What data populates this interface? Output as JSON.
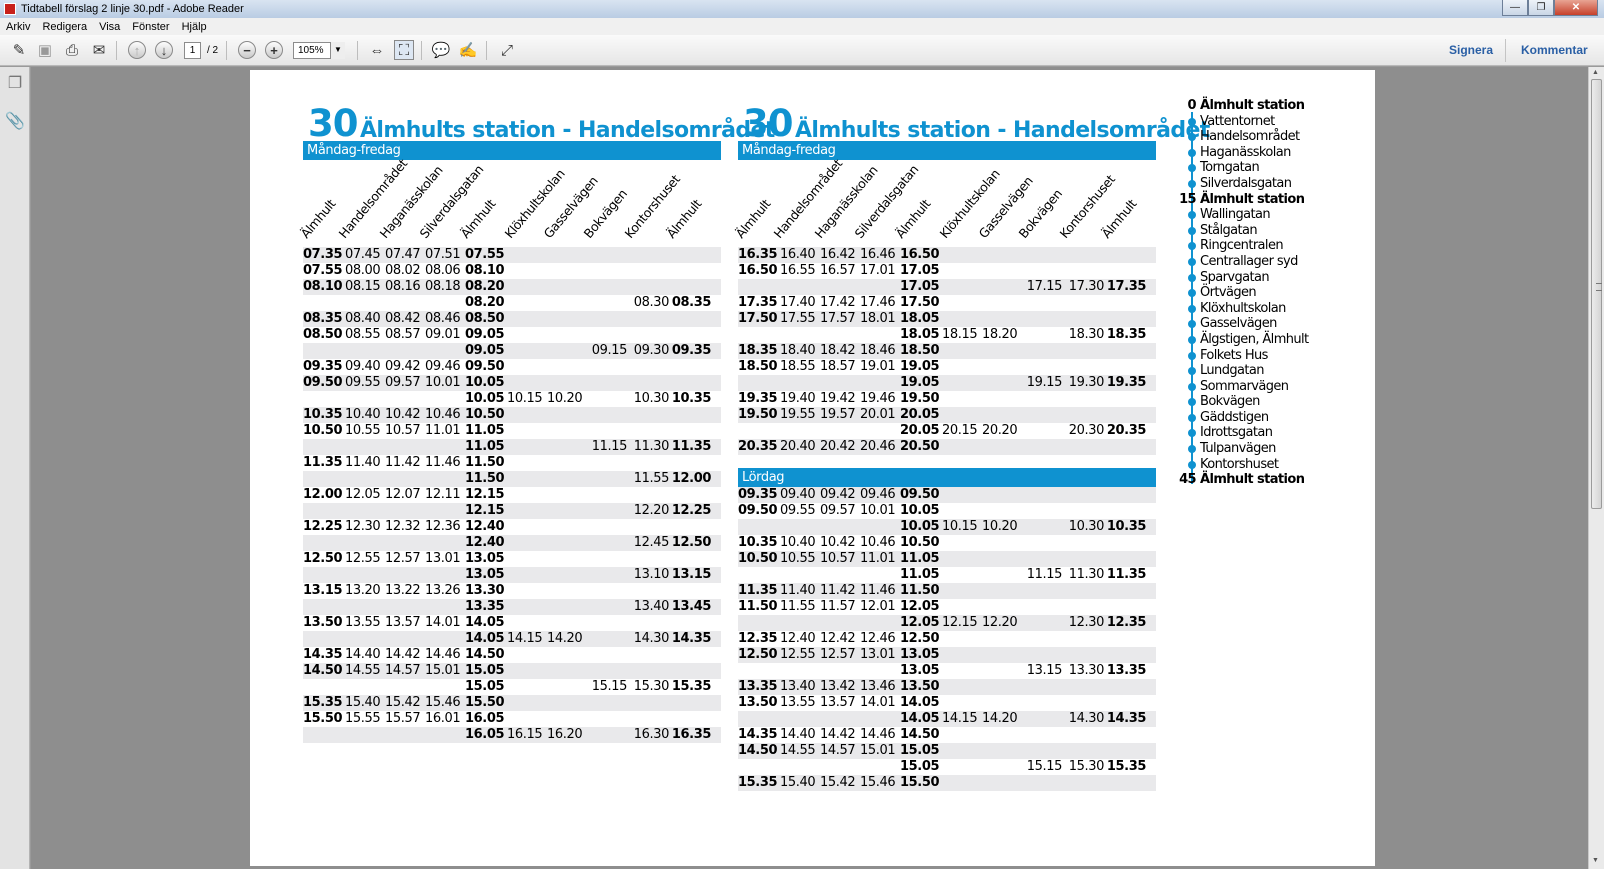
{
  "window": {
    "title": "Tidtabell förslag 2 linje 30.pdf - Adobe Reader",
    "btn_min": "—",
    "btn_max": "❐",
    "btn_close": "✕"
  },
  "menu": [
    "Arkiv",
    "Redigera",
    "Visa",
    "Fönster",
    "Hjälp"
  ],
  "toolbar": {
    "page_current": "1",
    "page_total": "/ 2",
    "zoom": "105%",
    "signera": "Signera",
    "kommentar": "Kommentar"
  },
  "accent_color": "#0f92d0",
  "timetable": {
    "route_number": "30",
    "route_name": "Älmhults station - Handelsområdet",
    "columns": [
      "Älmhult",
      "Handelsområdet",
      "Haganässkolan",
      "Silverdalsgatan",
      "Älmhult",
      "Klöxhultskolan",
      "Gasselvägen",
      "Bokvägen",
      "Kontorshuset",
      "Älmhult"
    ],
    "weekday_label": "Måndag-fredag",
    "saturday_label": "Lördag",
    "weekday_left": [
      [
        "07.35",
        "07.45",
        "07.47",
        "07.51",
        "07.55",
        "",
        "",
        "",
        "",
        ""
      ],
      [
        "07.55",
        "08.00",
        "08.02",
        "08.06",
        "08.10",
        "",
        "",
        "",
        "",
        ""
      ],
      [
        "08.10",
        "08.15",
        "08.16",
        "08.18",
        "08.20",
        "",
        "",
        "",
        "",
        ""
      ],
      [
        "",
        "",
        "",
        "",
        "08.20",
        "",
        "",
        "",
        "08.30",
        "08.35"
      ],
      [
        "08.35",
        "08.40",
        "08.42",
        "08.46",
        "08.50",
        "",
        "",
        "",
        "",
        ""
      ],
      [
        "08.50",
        "08.55",
        "08.57",
        "09.01",
        "09.05",
        "",
        "",
        "",
        "",
        ""
      ],
      [
        "",
        "",
        "",
        "",
        "09.05",
        "",
        "",
        "09.15",
        "09.30",
        "09.35"
      ],
      [
        "09.35",
        "09.40",
        "09.42",
        "09.46",
        "09.50",
        "",
        "",
        "",
        "",
        ""
      ],
      [
        "09.50",
        "09.55",
        "09.57",
        "10.01",
        "10.05",
        "",
        "",
        "",
        "",
        ""
      ],
      [
        "",
        "",
        "",
        "",
        "10.05",
        "10.15",
        "10.20",
        "",
        "10.30",
        "10.35"
      ],
      [
        "10.35",
        "10.40",
        "10.42",
        "10.46",
        "10.50",
        "",
        "",
        "",
        "",
        ""
      ],
      [
        "10.50",
        "10.55",
        "10.57",
        "11.01",
        "11.05",
        "",
        "",
        "",
        "",
        ""
      ],
      [
        "",
        "",
        "",
        "",
        "11.05",
        "",
        "",
        "11.15",
        "11.30",
        "11.35"
      ],
      [
        "11.35",
        "11.40",
        "11.42",
        "11.46",
        "11.50",
        "",
        "",
        "",
        "",
        ""
      ],
      [
        "",
        "",
        "",
        "",
        "11.50",
        "",
        "",
        "",
        "11.55",
        "12.00"
      ],
      [
        "12.00",
        "12.05",
        "12.07",
        "12.11",
        "12.15",
        "",
        "",
        "",
        "",
        ""
      ],
      [
        "",
        "",
        "",
        "",
        "12.15",
        "",
        "",
        "",
        "12.20",
        "12.25"
      ],
      [
        "12.25",
        "12.30",
        "12.32",
        "12.36",
        "12.40",
        "",
        "",
        "",
        "",
        ""
      ],
      [
        "",
        "",
        "",
        "",
        "12.40",
        "",
        "",
        "",
        "12.45",
        "12.50"
      ],
      [
        "12.50",
        "12.55",
        "12.57",
        "13.01",
        "13.05",
        "",
        "",
        "",
        "",
        ""
      ],
      [
        "",
        "",
        "",
        "",
        "13.05",
        "",
        "",
        "",
        "13.10",
        "13.15"
      ],
      [
        "13.15",
        "13.20",
        "13.22",
        "13.26",
        "13.30",
        "",
        "",
        "",
        "",
        ""
      ],
      [
        "",
        "",
        "",
        "",
        "13.35",
        "",
        "",
        "",
        "13.40",
        "13.45"
      ],
      [
        "13.50",
        "13.55",
        "13.57",
        "14.01",
        "14.05",
        "",
        "",
        "",
        "",
        ""
      ],
      [
        "",
        "",
        "",
        "",
        "14.05",
        "14.15",
        "14.20",
        "",
        "14.30",
        "14.35"
      ],
      [
        "14.35",
        "14.40",
        "14.42",
        "14.46",
        "14.50",
        "",
        "",
        "",
        "",
        ""
      ],
      [
        "14.50",
        "14.55",
        "14.57",
        "15.01",
        "15.05",
        "",
        "",
        "",
        "",
        ""
      ],
      [
        "",
        "",
        "",
        "",
        "15.05",
        "",
        "",
        "15.15",
        "15.30",
        "15.35"
      ],
      [
        "15.35",
        "15.40",
        "15.42",
        "15.46",
        "15.50",
        "",
        "",
        "",
        "",
        ""
      ],
      [
        "15.50",
        "15.55",
        "15.57",
        "16.01",
        "16.05",
        "",
        "",
        "",
        "",
        ""
      ],
      [
        "",
        "",
        "",
        "",
        "16.05",
        "16.15",
        "16.20",
        "",
        "16.30",
        "16.35"
      ]
    ],
    "weekday_right": [
      [
        "16.35",
        "16.40",
        "16.42",
        "16.46",
        "16.50",
        "",
        "",
        "",
        "",
        ""
      ],
      [
        "16.50",
        "16.55",
        "16.57",
        "17.01",
        "17.05",
        "",
        "",
        "",
        "",
        ""
      ],
      [
        "",
        "",
        "",
        "",
        "17.05",
        "",
        "",
        "17.15",
        "17.30",
        "17.35"
      ],
      [
        "17.35",
        "17.40",
        "17.42",
        "17.46",
        "17.50",
        "",
        "",
        "",
        "",
        ""
      ],
      [
        "17.50",
        "17.55",
        "17.57",
        "18.01",
        "18.05",
        "",
        "",
        "",
        "",
        ""
      ],
      [
        "",
        "",
        "",
        "",
        "18.05",
        "18.15",
        "18.20",
        "",
        "18.30",
        "18.35"
      ],
      [
        "18.35",
        "18.40",
        "18.42",
        "18.46",
        "18.50",
        "",
        "",
        "",
        "",
        ""
      ],
      [
        "18.50",
        "18.55",
        "18.57",
        "19.01",
        "19.05",
        "",
        "",
        "",
        "",
        ""
      ],
      [
        "",
        "",
        "",
        "",
        "19.05",
        "",
        "",
        "19.15",
        "19.30",
        "19.35"
      ],
      [
        "19.35",
        "19.40",
        "19.42",
        "19.46",
        "19.50",
        "",
        "",
        "",
        "",
        ""
      ],
      [
        "19.50",
        "19.55",
        "19.57",
        "20.01",
        "20.05",
        "",
        "",
        "",
        "",
        ""
      ],
      [
        "",
        "",
        "",
        "",
        "20.05",
        "20.15",
        "20.20",
        "",
        "20.30",
        "20.35"
      ],
      [
        "20.35",
        "20.40",
        "20.42",
        "20.46",
        "20.50",
        "",
        "",
        "",
        "",
        ""
      ]
    ],
    "saturday": [
      [
        "09.35",
        "09.40",
        "09.42",
        "09.46",
        "09.50",
        "",
        "",
        "",
        "",
        ""
      ],
      [
        "09.50",
        "09.55",
        "09.57",
        "10.01",
        "10.05",
        "",
        "",
        "",
        "",
        ""
      ],
      [
        "",
        "",
        "",
        "",
        "10.05",
        "10.15",
        "10.20",
        "",
        "10.30",
        "10.35"
      ],
      [
        "10.35",
        "10.40",
        "10.42",
        "10.46",
        "10.50",
        "",
        "",
        "",
        "",
        ""
      ],
      [
        "10.50",
        "10.55",
        "10.57",
        "11.01",
        "11.05",
        "",
        "",
        "",
        "",
        ""
      ],
      [
        "",
        "",
        "",
        "",
        "11.05",
        "",
        "",
        "11.15",
        "11.30",
        "11.35"
      ],
      [
        "11.35",
        "11.40",
        "11.42",
        "11.46",
        "11.50",
        "",
        "",
        "",
        "",
        ""
      ],
      [
        "11.50",
        "11.55",
        "11.57",
        "12.01",
        "12.05",
        "",
        "",
        "",
        "",
        ""
      ],
      [
        "",
        "",
        "",
        "",
        "12.05",
        "12.15",
        "12.20",
        "",
        "12.30",
        "12.35"
      ],
      [
        "12.35",
        "12.40",
        "12.42",
        "12.46",
        "12.50",
        "",
        "",
        "",
        "",
        ""
      ],
      [
        "12.50",
        "12.55",
        "12.57",
        "13.01",
        "13.05",
        "",
        "",
        "",
        "",
        ""
      ],
      [
        "",
        "",
        "",
        "",
        "13.05",
        "",
        "",
        "13.15",
        "13.30",
        "13.35"
      ],
      [
        "13.35",
        "13.40",
        "13.42",
        "13.46",
        "13.50",
        "",
        "",
        "",
        "",
        ""
      ],
      [
        "13.50",
        "13.55",
        "13.57",
        "14.01",
        "14.05",
        "",
        "",
        "",
        "",
        ""
      ],
      [
        "",
        "",
        "",
        "",
        "14.05",
        "14.15",
        "14.20",
        "",
        "14.30",
        "14.35"
      ],
      [
        "14.35",
        "14.40",
        "14.42",
        "14.46",
        "14.50",
        "",
        "",
        "",
        "",
        ""
      ],
      [
        "14.50",
        "14.55",
        "14.57",
        "15.01",
        "15.05",
        "",
        "",
        "",
        "",
        ""
      ],
      [
        "",
        "",
        "",
        "",
        "15.05",
        "",
        "",
        "15.15",
        "15.30",
        "15.35"
      ],
      [
        "15.35",
        "15.40",
        "15.42",
        "15.46",
        "15.50",
        "",
        "",
        "",
        "",
        ""
      ]
    ]
  },
  "stops": [
    {
      "min": "0",
      "name": "Älmhult station",
      "major": true
    },
    {
      "min": "",
      "name": "Vattentornet",
      "major": false
    },
    {
      "min": "",
      "name": "Handelsområdet",
      "major": false
    },
    {
      "min": "",
      "name": "Haganässkolan",
      "major": false
    },
    {
      "min": "",
      "name": "Torngatan",
      "major": false
    },
    {
      "min": "",
      "name": "Silverdalsgatan",
      "major": false
    },
    {
      "min": "15",
      "name": "Älmhult station",
      "major": true
    },
    {
      "min": "",
      "name": "Wallingatan",
      "major": false
    },
    {
      "min": "",
      "name": "Stålgatan",
      "major": false
    },
    {
      "min": "",
      "name": "Ringcentralen",
      "major": false
    },
    {
      "min": "",
      "name": "Centrallager syd",
      "major": false
    },
    {
      "min": "",
      "name": "Sparvgatan",
      "major": false
    },
    {
      "min": "",
      "name": "Örtvägen",
      "major": false
    },
    {
      "min": "",
      "name": "Klöxhultskolan",
      "major": false
    },
    {
      "min": "",
      "name": "Gasselvägen",
      "major": false
    },
    {
      "min": "",
      "name": "Älgstigen, Älmhult",
      "major": false
    },
    {
      "min": "",
      "name": "Folkets Hus",
      "major": false
    },
    {
      "min": "",
      "name": "Lundgatan",
      "major": false
    },
    {
      "min": "",
      "name": "Sommarvägen",
      "major": false
    },
    {
      "min": "",
      "name": "Bokvägen",
      "major": false
    },
    {
      "min": "",
      "name": "Gäddstigen",
      "major": false
    },
    {
      "min": "",
      "name": "Idrottsgatan",
      "major": false
    },
    {
      "min": "",
      "name": "Tulpanvägen",
      "major": false
    },
    {
      "min": "",
      "name": "Kontorshuset",
      "major": false
    },
    {
      "min": "45",
      "name": "Älmhult station",
      "major": true
    }
  ]
}
